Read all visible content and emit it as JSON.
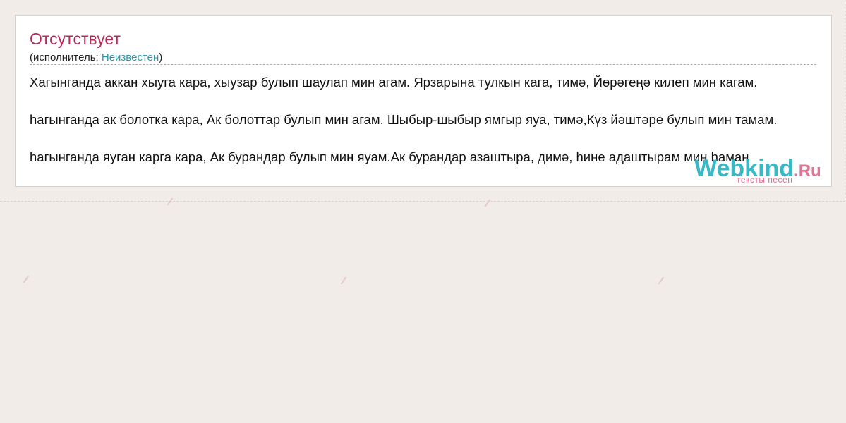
{
  "song": {
    "title": "Отсутствует",
    "performer_prefix": "(исполнитель: ",
    "performer_name": "Неизвестен",
    "performer_suffix": ")"
  },
  "lyrics": {
    "lines": [
      "Хагынганда аккан хыуга кара, хыузар булып шаулап мин агам. Ярзарына тулкын кага, тимә, Йөрәгеңә килеп мин кагам.",
      "hагынганда ак болотка кара, Ак болоттар булып мин агам. Шыбыр-шыбыр ямгыр яуа, тимә,Күз йәштәре булып мин тамам.",
      "hагынганда яуган карга кара, Ак бурандар булып мин яуам.Ак бурандар азаштыра, димә, hине адаштырам мин hаман"
    ]
  },
  "watermark": {
    "brand": "Webkind",
    "tld": ".Ru",
    "tagline": "тексты песен"
  },
  "colors": {
    "background": "#f1ece8",
    "title": "#b82a57",
    "link": "#2a98a8",
    "watermark_brand": "#2fb5c2",
    "watermark_accent": "#e46b8e"
  }
}
